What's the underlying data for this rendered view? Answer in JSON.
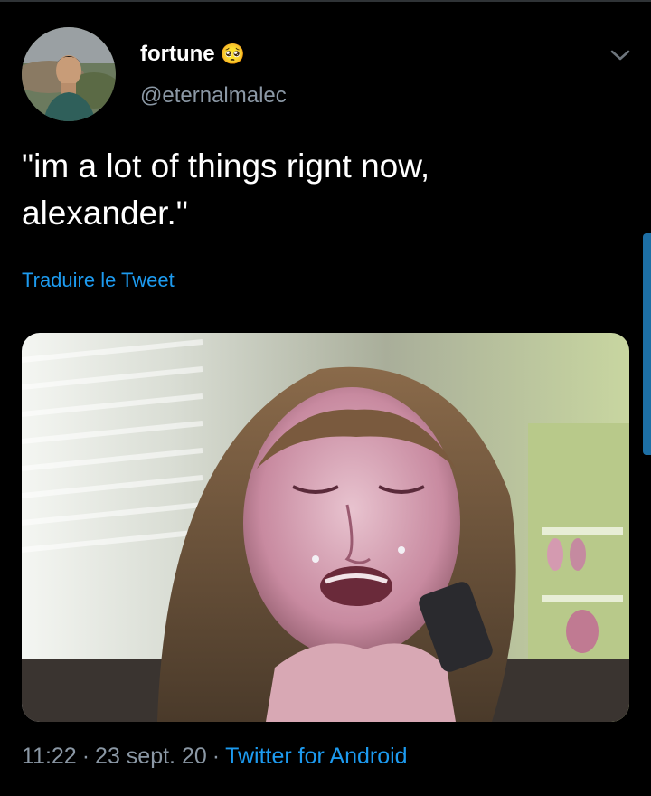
{
  "tweet": {
    "author": {
      "display_name": "fortune",
      "name_emoji": "🥺",
      "handle": "@eternalmalec"
    },
    "text": "\"im a lot of things rignt now,\nalexander.\"",
    "translate_label": "Traduire le Tweet",
    "meta": {
      "time": "11:22",
      "separator": "·",
      "date": "23 sept. 20",
      "source": "Twitter for Android"
    }
  },
  "colors": {
    "background": "#000000",
    "link": "#1d9bf0",
    "secondary_text": "#8b98a5",
    "primary_text": "#ffffff"
  },
  "icons": {
    "menu_caret": "chevron-down-icon"
  }
}
